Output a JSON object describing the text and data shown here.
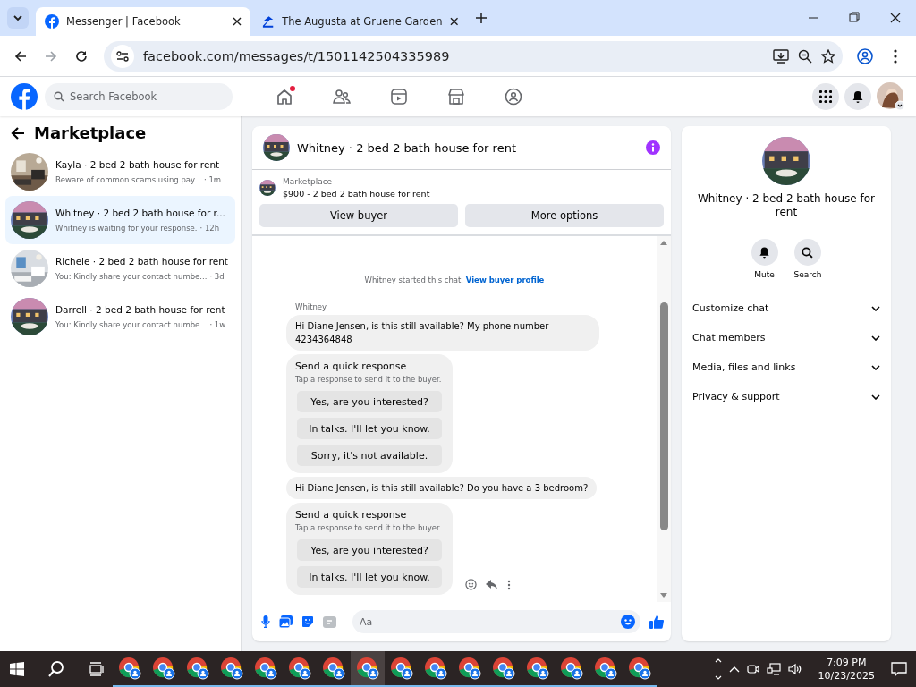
{
  "browser": {
    "tabs": [
      {
        "title": "Messenger | Facebook",
        "selected": true
      },
      {
        "title": "The Augusta at Gruene Garden",
        "selected": false
      }
    ],
    "url": "facebook.com/messages/t/1501142504335989"
  },
  "header": {
    "search": {
      "placeholder": "Search Facebook"
    },
    "home_notification": true
  },
  "sidebar": {
    "title": "Marketplace",
    "chats": [
      {
        "title": "Kayla · 2 bed 2 bath house for rent",
        "preview": "Beware of common scams using pay...",
        "time": "· 1m",
        "selected": false
      },
      {
        "title": "Whitney · 2 bed 2 bath house for r...",
        "preview": "Whitney is waiting for your response.",
        "time": "· 12h",
        "selected": true
      },
      {
        "title": "Richele · 2 bed 2 bath house for rent",
        "preview": "You: Kindly share your contact numbe...",
        "time": "· 3d",
        "selected": false
      },
      {
        "title": "Darrell · 2 bed 2 bath house for rent",
        "preview": "You: Kindly share your contact numbe...",
        "time": "· 1w",
        "selected": false
      }
    ]
  },
  "conversation": {
    "title": "Whitney · 2 bed 2 bath house for rent",
    "listing": {
      "label": "Marketplace",
      "price_title": "$900 - 2 bed 2 bath house for rent"
    },
    "actions": [
      "View buyer",
      "More options"
    ],
    "messages": [
      {
        "kind": "system",
        "text": "Whitney started this chat.",
        "link": "View buyer profile"
      },
      {
        "kind": "sender",
        "text": "Whitney"
      },
      {
        "kind": "bubble",
        "text": "Hi Diane Jensen, is this still available? My phone number 4234364848"
      },
      {
        "kind": "quick",
        "title": "Send a quick response",
        "subtitle": "Tap a response to send it to the buyer.",
        "options": [
          "Yes, are you interested?",
          "In talks. I'll let you know.",
          "Sorry, it's not available."
        ]
      },
      {
        "kind": "bubble",
        "text": "Hi Diane Jensen, is this still available? Do you have a 3 bedroom?"
      },
      {
        "kind": "quick",
        "title": "Send a quick response",
        "subtitle": "Tap a response to send it to the buyer.",
        "options": [
          "Yes, are you interested?",
          "In talks. I'll let you know."
        ],
        "hover_actions": true
      }
    ],
    "composer": {
      "placeholder": "Aa"
    }
  },
  "details": {
    "title": "Whitney · 2 bed 2 bath house for rent",
    "buttons": [
      {
        "label": "Mute",
        "kind": "bell"
      },
      {
        "label": "Search",
        "kind": "search"
      }
    ],
    "sections": [
      {
        "label": "Customize chat",
        "expanded": false
      },
      {
        "label": "Chat members",
        "expanded": false
      },
      {
        "label": "Media, files and links",
        "expanded": false
      },
      {
        "label": "Privacy & support",
        "expanded": false
      }
    ]
  },
  "taskbar": {
    "apps": [
      {
        "selected": false
      },
      {
        "selected": false
      },
      {
        "selected": false
      },
      {
        "selected": false
      },
      {
        "selected": false
      },
      {
        "selected": false
      },
      {
        "selected": false
      },
      {
        "selected": true
      },
      {
        "selected": false
      },
      {
        "selected": false
      },
      {
        "selected": false
      },
      {
        "selected": false
      },
      {
        "selected": false
      },
      {
        "selected": false
      },
      {
        "selected": false
      },
      {
        "selected": false
      }
    ],
    "time": "7:09 PM",
    "date": "10/23/2025"
  }
}
